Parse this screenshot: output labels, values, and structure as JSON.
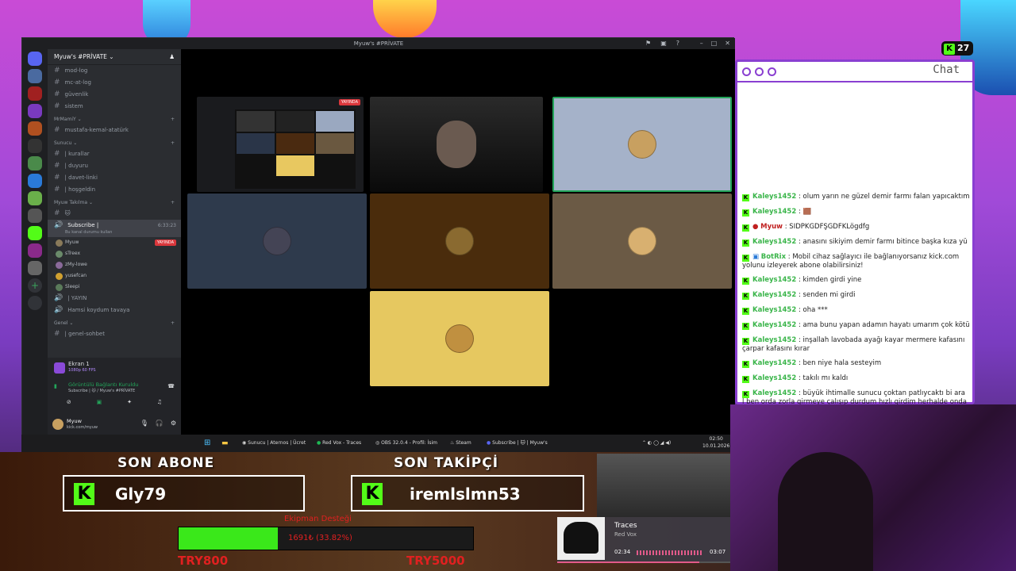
{
  "discord": {
    "window_title": "Myuw's #PRİVATE",
    "server_name": "Myuw's #PRİVATE",
    "channels_top": [
      "mod-log",
      "mc-at-log",
      "güvenlik",
      "sistem"
    ],
    "cat_mamiy": "MrMamiY",
    "ch_mustafa": "mustafa-kemal-atatürk",
    "cat_sunucu": "Sunucu",
    "sunucu_channels": [
      "| kurallar",
      "| duyuru",
      "| davet-linki",
      "| hoşgeldin"
    ],
    "cat_myuw": "Myuw Takılma",
    "active_channel": "Subscribe |",
    "active_channel_sub": "Bu kanal durumu kullan",
    "active_time": "6:33:23",
    "voice_users": [
      "Myuw",
      "sTreex",
      "zMy-lowe",
      "yusefcan",
      "Sleepi"
    ],
    "live_badge": "YAYINDA",
    "yayin": "| YAYIN",
    "hamsi": "Hamsi koydum tavaya",
    "cat_genel": "Genel",
    "genel_sohbet": "| genel-sohbet",
    "screen_title": "Ekran 1",
    "screen_sub": "1080p 60 FPS",
    "rtc_status": "Görüntülü Bağlantı Kuruldu",
    "rtc_sub": "Subscribe | 🐱 / Myuw's #PRİVATE",
    "user_name": "Myuw",
    "user_status": "kick.com/myuw"
  },
  "taskbar": {
    "items": [
      "Sunucu | Aternos | Ücret",
      "Red Vox - Traces",
      "OBS 32.0.4 - Profil: İsim",
      "Steam",
      "Subscribe | 🐱 | Myuw's"
    ],
    "time": "02:50",
    "date": "10.01.2026"
  },
  "chat": {
    "title": "Chat",
    "viewers": "27",
    "messages": [
      {
        "user": "Kaleys1452",
        "text": ": olum yarın ne güzel demir farmı falan yapıcaktım"
      },
      {
        "user": "Kaleys1452",
        "text": ": 🟫"
      },
      {
        "user": "Myuw",
        "text": ": SİDPKGDFŞGDFKLögdfg"
      },
      {
        "user": "Kaleys1452",
        "text": ": anasını sikiyim demir farmı bitince başka kıza yü"
      },
      {
        "user": "BotRix",
        "text": ": Mobil cihaz sağlayıcı ile bağlanıyorsanız kick.com yolunu izleyerek abone olabilirsiniz!"
      },
      {
        "user": "Kaleys1452",
        "text": ": kimden girdi yine"
      },
      {
        "user": "Kaleys1452",
        "text": ": senden mi girdi"
      },
      {
        "user": "Kaleys1452",
        "text": ": oha ***"
      },
      {
        "user": "Kaleys1452",
        "text": ": ama bunu yapan adamın hayatı umarım çok kötü"
      },
      {
        "user": "Kaleys1452",
        "text": ": inşallah lavobada ayağı kayar mermere kafasını çarpar kafasını kırar"
      },
      {
        "user": "Kaleys1452",
        "text": ": ben niye hala sesteyim"
      },
      {
        "user": "Kaleys1452",
        "text": ": takılı mı kaldı"
      },
      {
        "user": "Kaleys1452",
        "text": ": büyük ihtimalle sunucu çoktan patlıycaktı bi ara l ben orda zorla girmeye çalışıp durdum hızlı girdim herhalde onda"
      }
    ]
  },
  "overlay": {
    "son_abone_label": "SON ABONE",
    "son_abone": "Gly79",
    "son_takipci_label": "SON TAKİPÇİ",
    "son_takipci": "iremlslmn53",
    "goal_title": "Ekipman Desteği",
    "goal_text": "1691₺ (33.82%)",
    "goal_progress": 0.3382,
    "goal_min": "TRY800",
    "goal_max": "TRY5000",
    "song_title": "Traces",
    "song_artist": "Red Vox",
    "song_elapsed": "02:34",
    "song_total": "03:07",
    "song_progress": 0.82
  },
  "colors": {
    "kick_green": "#53fc18",
    "chat_border": "#8a3fd1",
    "discord_bg": "#2b2d31"
  }
}
